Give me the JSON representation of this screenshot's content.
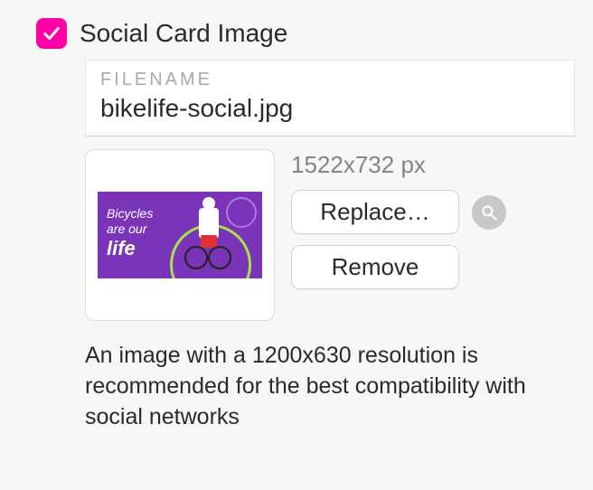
{
  "section": {
    "title": "Social Card Image",
    "checked": true
  },
  "filename": {
    "label": "FILENAME",
    "value": "bikelife-social.jpg"
  },
  "image": {
    "dimensions": "1522x732 px",
    "thumb_text_line1": "Bicycles",
    "thumb_text_line2": "are our",
    "thumb_text_life": "life"
  },
  "buttons": {
    "replace": "Replace…",
    "remove": "Remove"
  },
  "hint": "An image with a 1200x630 resolution is recommended for the best compatibility with social networks"
}
